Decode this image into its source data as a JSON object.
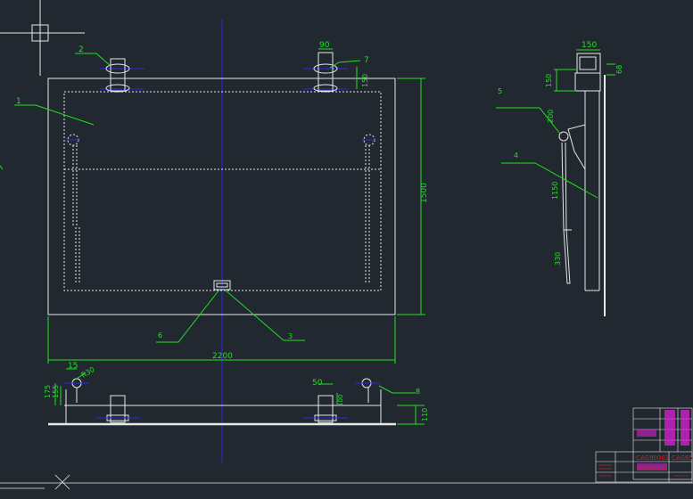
{
  "colors": {
    "background": "#212830",
    "outline": "#e8e8e8",
    "dimension": "#22e022",
    "centerline": "#2a2ae6",
    "hidden": "#e8e8e8",
    "titleblock_text": "#e02020",
    "titleblock_fill": "#d020d0"
  },
  "callouts": {
    "c1": "1",
    "c2": "2",
    "c3": "3",
    "c4": "4",
    "c5": "5",
    "c6": "6",
    "c7": "7",
    "c8": "8"
  },
  "dimensions": {
    "width_total": "2200",
    "height_total": "1500",
    "bolt_width": "90",
    "bolt_offset": "150",
    "side_top_width": "150",
    "side_small": "68",
    "side_height": "150",
    "hinge_200": "200",
    "arm_1150": "1150",
    "arm_330": "330",
    "bottom_15": "15",
    "bottom_r30": "R30",
    "bottom_175": "175",
    "bottom_155": "155",
    "bottom_50": "50",
    "bottom_100": "100",
    "bottom_110": "110"
  },
  "title_block": {
    "drawing_no": "CAG90001",
    "scale_code": "CAG65",
    "description": "XXXXXXXXXX"
  }
}
